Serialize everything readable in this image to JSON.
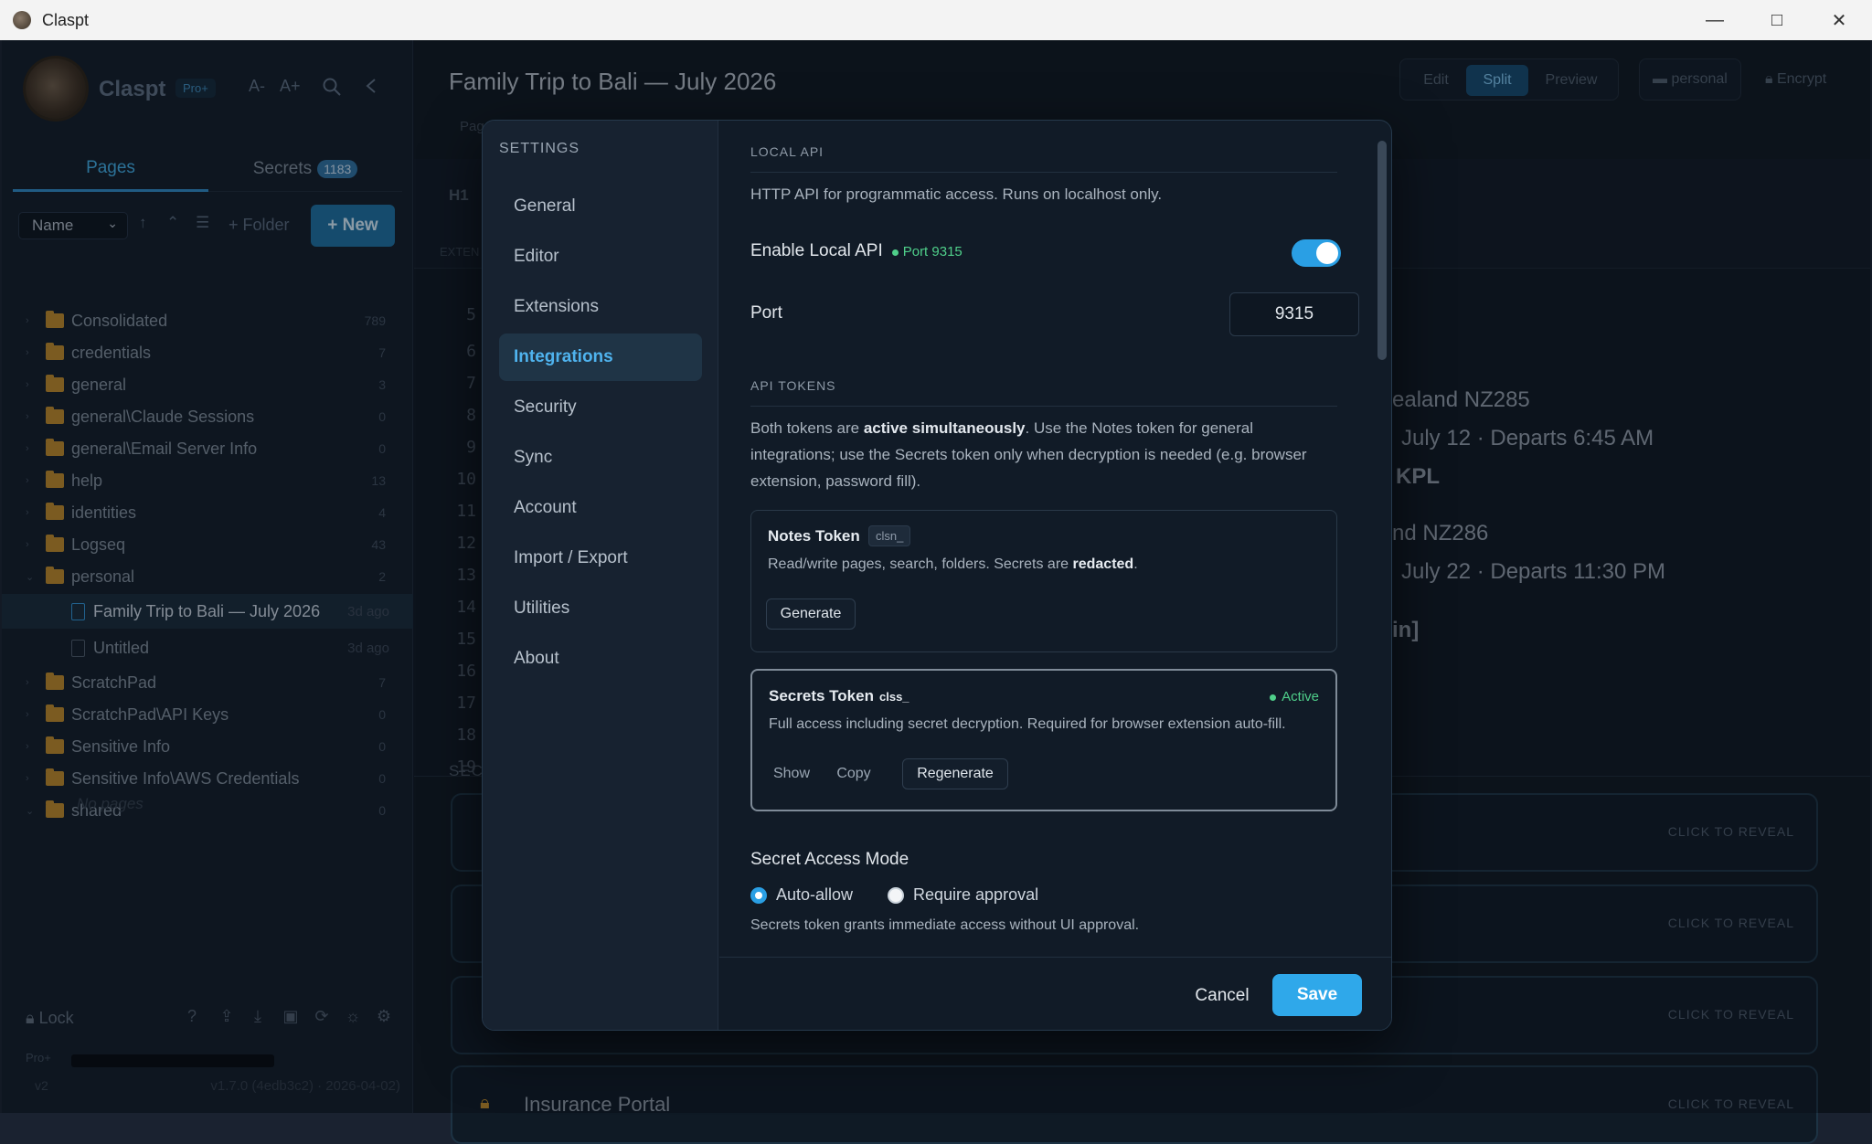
{
  "window": {
    "title": "Claspt",
    "minimize_icon": "—",
    "maximize_icon": "□",
    "close_icon": "✕"
  },
  "sidebar": {
    "brand": "Claspt",
    "plan_badge": "Pro+",
    "font_smaller": "A-",
    "font_larger": "A+",
    "tabs": [
      {
        "label": "Pages"
      },
      {
        "label": "Secrets",
        "count": "1183"
      }
    ],
    "sort_select": "Name",
    "folder_button": "+ Folder",
    "new_button": "+ New",
    "tree": [
      {
        "label": "Consolidated",
        "count": "789"
      },
      {
        "label": "credentials",
        "count": "7"
      },
      {
        "label": "general",
        "count": "3"
      },
      {
        "label": "general\\Claude Sessions",
        "count": "0"
      },
      {
        "label": "general\\Email Server Info",
        "count": "0"
      },
      {
        "label": "help",
        "count": "13"
      },
      {
        "label": "identities",
        "count": "4"
      },
      {
        "label": "Logseq",
        "count": "43"
      },
      {
        "label": "personal",
        "count": "2"
      },
      {
        "label": "Family Trip to Bali — July 2026",
        "ago": "3d ago"
      },
      {
        "label": "Untitled",
        "ago": "3d ago"
      },
      {
        "label": "ScratchPad",
        "count": "7"
      },
      {
        "label": "ScratchPad\\API Keys",
        "count": "0"
      },
      {
        "label": "Sensitive Info",
        "count": "0"
      },
      {
        "label": "Sensitive Info\\AWS Credentials",
        "count": "0"
      },
      {
        "label": "shared",
        "count": "0"
      }
    ],
    "no_pages": "No pages",
    "lock_label": "Lock",
    "footer_plan": "Pro+",
    "version_left": "v2",
    "version_right": "v1.7.0 (4edb3c2) · 2026-04-02)"
  },
  "main": {
    "doc_title": "Family Trip to Bali — July 2026",
    "modes": [
      "Edit",
      "Split",
      "Preview"
    ],
    "folder_label": "personal",
    "encrypt_label": "Encrypt",
    "page_label": "Pag",
    "h1_label": "H1",
    "ext_label": "EXTEN",
    "line_numbers": [
      "5",
      "6",
      "7",
      "8",
      "9",
      "10",
      "11",
      "12",
      "13",
      "14",
      "15",
      "16",
      "17",
      "18",
      "19"
    ],
    "preview_lines": [
      "ealand NZ285",
      "July 12 · Departs 6:45 AM",
      "KPL",
      "nd NZ286",
      "July 22 · Departs 11:30 PM",
      "in]"
    ],
    "secrets_header": "SECR",
    "reveal_label": "CLICK TO REVEAL",
    "last_secret_title": "Insurance Portal"
  },
  "settings": {
    "header": "SETTINGS",
    "nav": [
      "General",
      "Editor",
      "Extensions",
      "Integrations",
      "Security",
      "Sync",
      "Account",
      "Import / Export",
      "Utilities",
      "About"
    ],
    "local_api": {
      "title": "LOCAL API",
      "desc": "HTTP API for programmatic access. Runs on localhost only.",
      "enable_label": "Enable Local API",
      "port_pill": "Port 9315",
      "enabled": true,
      "port_label": "Port",
      "port_value": "9315"
    },
    "tokens": {
      "title": "API TOKENS",
      "desc_pre": "Both tokens are ",
      "desc_bold": "active simultaneously",
      "desc_post": ". Use the Notes token for general integrations; use the Secrets token only when decryption is needed (e.g. browser extension, password fill).",
      "notes": {
        "name": "Notes Token",
        "prefix": "clsn_",
        "desc_pre": "Read/write pages, search, folders. Secrets are ",
        "desc_bold": "redacted",
        "desc_post": ".",
        "generate": "Generate"
      },
      "secrets": {
        "name": "Secrets Token",
        "prefix": "clss_",
        "status": "Active",
        "desc": "Full access including secret decryption. Required for browser extension auto-fill.",
        "show": "Show",
        "copy": "Copy",
        "regenerate": "Regenerate"
      }
    },
    "access_mode": {
      "title": "Secret Access Mode",
      "options": [
        "Auto-allow",
        "Require approval"
      ],
      "selected": "Auto-allow",
      "hint": "Secrets token grants immediate access without UI approval."
    },
    "cancel": "Cancel",
    "save": "Save"
  }
}
